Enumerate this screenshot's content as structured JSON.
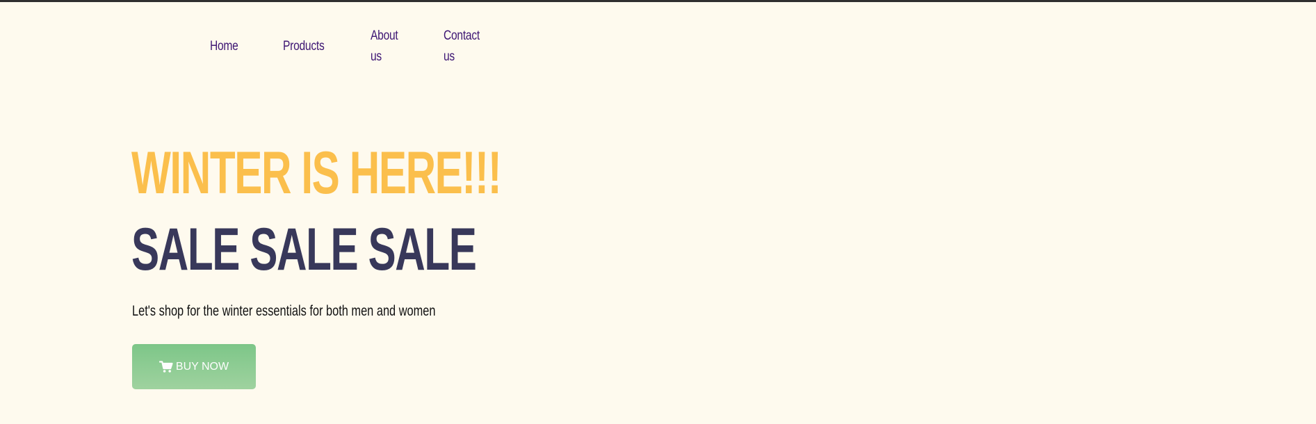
{
  "nav": {
    "items": [
      {
        "label": "Home"
      },
      {
        "label": "Products"
      },
      {
        "label": "About us"
      },
      {
        "label": "Contact us"
      }
    ]
  },
  "hero": {
    "title": "WINTER IS HERE!!!",
    "subtitle": "SALE SALE SALE",
    "text": "Let's shop for the winter essentials for both men and women",
    "button_label": "BUY NOW",
    "button_icon": "cart-icon"
  },
  "colors": {
    "background": "#fefaee",
    "nav_link": "#3d1573",
    "title": "#fbbf4c",
    "subtitle": "#38385a",
    "button": "#85c98e"
  }
}
